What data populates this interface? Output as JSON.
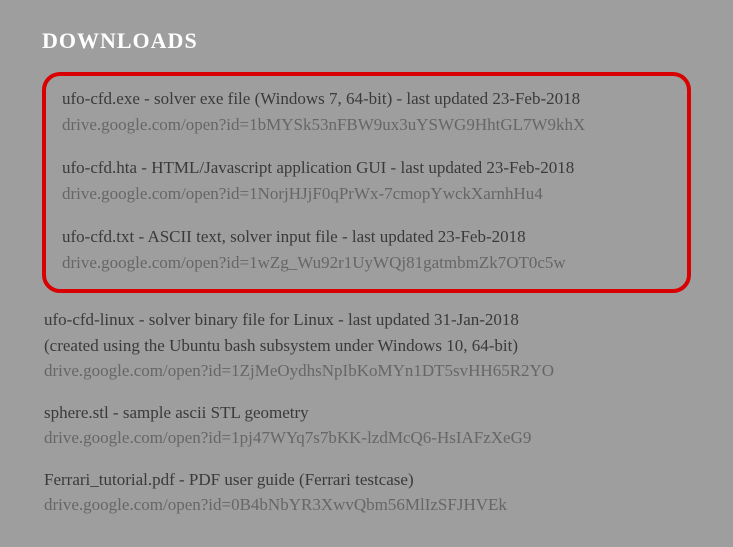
{
  "title": "DOWNLOADS",
  "highlighted": [
    {
      "desc": "ufo-cfd.exe - solver exe file (Windows 7, 64-bit) - last updated 23-Feb-2018",
      "url": "drive.google.com/open?id=1bMYSk53nFBW9ux3uYSWG9HhtGL7W9khX"
    },
    {
      "desc": "ufo-cfd.hta - HTML/Javascript application GUI - last updated 23-Feb-2018",
      "url": "drive.google.com/open?id=1NorjHJjF0qPrWx-7cmopYwckXarnhHu4"
    },
    {
      "desc": "ufo-cfd.txt - ASCII text, solver input file - last updated 23-Feb-2018",
      "url": "drive.google.com/open?id=1wZg_Wu92r1UyWQj81gatmbmZk7OT0c5w"
    }
  ],
  "other": [
    {
      "desc": "ufo-cfd-linux - solver binary file for Linux - last updated 31-Jan-2018",
      "desc2": "(created using the Ubuntu bash subsystem under Windows 10, 64-bit)",
      "url": "drive.google.com/open?id=1ZjMeOydhsNpIbKoMYn1DT5svHH65R2YO"
    },
    {
      "desc": "sphere.stl - sample ascii STL geometry",
      "url": "drive.google.com/open?id=1pj47WYq7s7bKK-lzdMcQ6-HsIAFzXeG9"
    },
    {
      "desc": "Ferrari_tutorial.pdf - PDF user guide (Ferrari testcase)",
      "url": "drive.google.com/open?id=0B4bNbYR3XwvQbm56MlIzSFJHVEk"
    }
  ]
}
